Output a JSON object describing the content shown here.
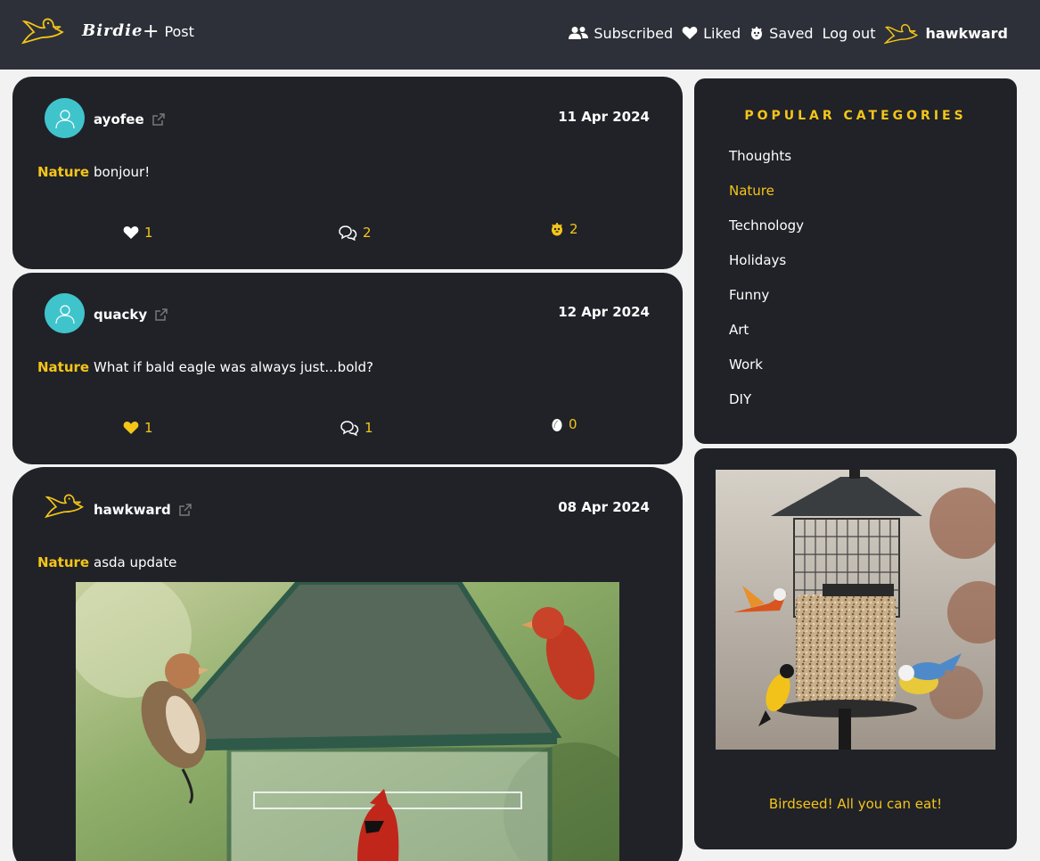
{
  "nav": {
    "brand": "Birdie",
    "post_label": "Post",
    "subscribed_label": "Subscribed",
    "liked_label": "Liked",
    "saved_label": "Saved",
    "logout_label": "Log out",
    "username": "hawkward"
  },
  "posts": [
    {
      "author": "ayofee",
      "date": "11 Apr 2024",
      "category": "Nature",
      "text": "bonjour!",
      "likes": "1",
      "comments": "2",
      "saves": "2"
    },
    {
      "author": "quacky",
      "date": "12 Apr 2024",
      "category": "Nature",
      "text": "What if bald eagle was always just...bold?",
      "likes": "1",
      "comments": "1",
      "saves": "0"
    },
    {
      "author": "hawkward",
      "date": "08 Apr 2024",
      "category": "Nature",
      "text": "asda update"
    }
  ],
  "sidebar": {
    "title": "POPULAR CATEGORIES",
    "categories": [
      "Thoughts",
      "Nature",
      "Technology",
      "Holidays",
      "Funny",
      "Art",
      "Work",
      "DIY"
    ],
    "ad_caption": "Birdseed! All you can eat!"
  },
  "colors": {
    "accent": "#f5c518",
    "card": "#202228",
    "nav": "#2d3038",
    "avatar": "#40c4cc"
  }
}
